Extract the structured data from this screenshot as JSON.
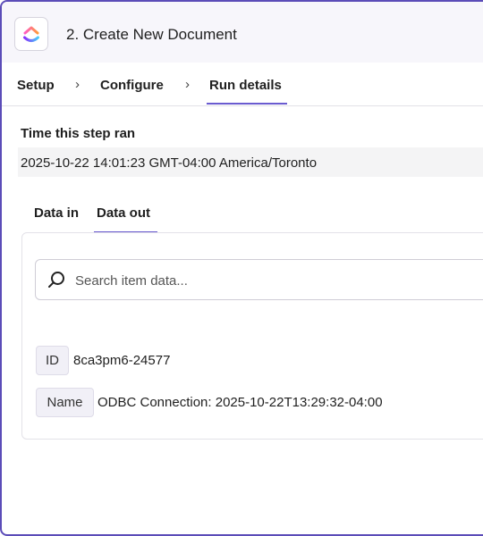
{
  "header": {
    "app_icon": "clickup-logo-icon",
    "title": "2. Create New Document"
  },
  "steps": [
    {
      "label": "Setup"
    },
    {
      "label": "Configure"
    },
    {
      "label": "Run details",
      "active": true
    }
  ],
  "run": {
    "time_label": "Time this step ran",
    "time_value": "2025-10-22 14:01:23 GMT-04:00 America/Toronto"
  },
  "data_tabs": [
    {
      "label": "Data in"
    },
    {
      "label": "Data out",
      "active": true
    }
  ],
  "search": {
    "placeholder": "Search item data...",
    "value": ""
  },
  "items": [
    {
      "key": "ID",
      "value": "8ca3pm6-24577"
    },
    {
      "key": "Name",
      "value": "ODBC Connection: 2025-10-22T13:29:32-04:00"
    }
  ],
  "colors": {
    "accent": "#6a5bd0",
    "frame_border": "#5b4cb8"
  }
}
